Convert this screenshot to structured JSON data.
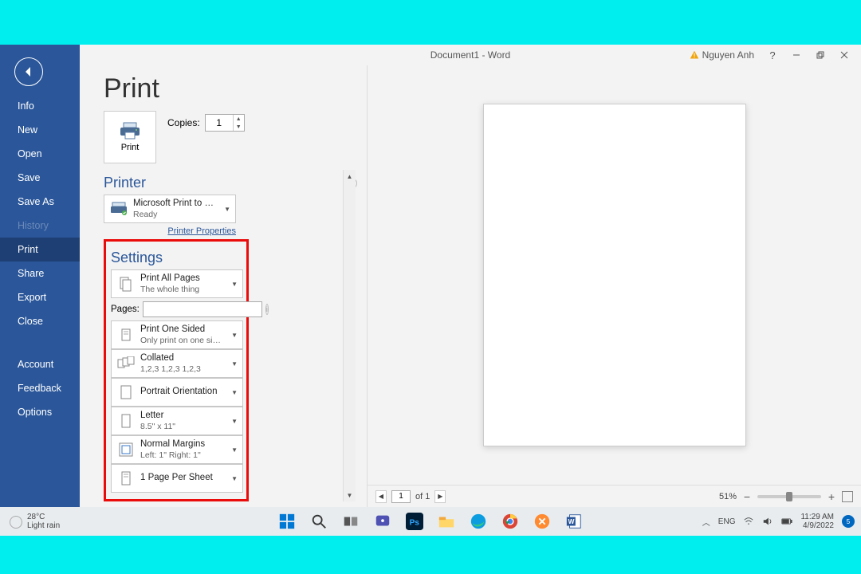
{
  "window": {
    "title": "Document1 - Word",
    "user": "Nguyen Anh"
  },
  "sidebar": {
    "items": [
      "Info",
      "New",
      "Open",
      "Save",
      "Save As",
      "History",
      "Print",
      "Share",
      "Export",
      "Close"
    ],
    "footer": [
      "Account",
      "Feedback",
      "Options"
    ],
    "active_index": 6,
    "disabled_index": 5
  },
  "print": {
    "heading": "Print",
    "button_label": "Print",
    "copies_label": "Copies:",
    "copies_value": "1",
    "printer_heading": "Printer",
    "printer_name": "Microsoft Print to PDF",
    "printer_status": "Ready",
    "printer_props": "Printer Properties",
    "settings_heading": "Settings",
    "pages_label": "Pages:",
    "pages_value": "",
    "options": {
      "scope": {
        "t": "Print All Pages",
        "s": "The whole thing"
      },
      "sides": {
        "t": "Print One Sided",
        "s": "Only print on one side of..."
      },
      "collate": {
        "t": "Collated",
        "s": "1,2,3   1,2,3   1,2,3"
      },
      "orient": {
        "t": "Portrait Orientation",
        "s": ""
      },
      "paper": {
        "t": "Letter",
        "s": "8.5\" x 11\""
      },
      "margins": {
        "t": "Normal Margins",
        "s": "Left: 1\"   Right: 1\""
      },
      "sheet": {
        "t": "1 Page Per Sheet",
        "s": ""
      }
    }
  },
  "preview": {
    "page_current": "1",
    "page_total": "of 1",
    "zoom": "51%   "
  },
  "taskbar": {
    "temp": "28°C",
    "cond": "Light rain",
    "lang": "ENG",
    "time": "11:29 AM",
    "date": "4/9/2022",
    "badge": "5"
  }
}
